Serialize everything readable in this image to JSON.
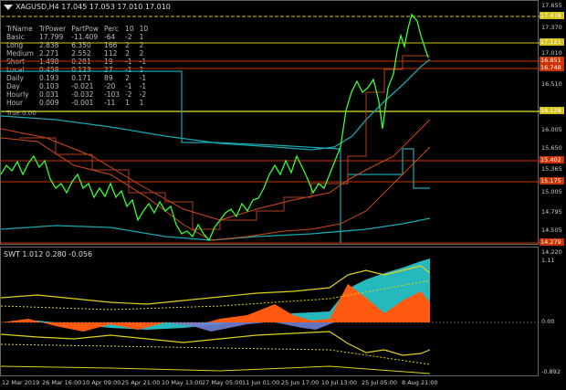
{
  "window": {
    "symbol_header": "XAGUSD,H4  17.045 17.053 17.010 17.010",
    "icon": "triangle-down-icon"
  },
  "stats_table": {
    "headers": [
      "TrName",
      "TrPower",
      "PartPow",
      "Perc",
      "10",
      "10"
    ],
    "rows": [
      [
        "Basic",
        "17.799",
        "-11.409",
        "-64",
        "-2",
        "1"
      ],
      [
        "Long",
        "2.838",
        "6.350",
        "166",
        "2",
        "2"
      ],
      [
        "Medium",
        "2.271",
        "2.552",
        "112",
        "2",
        "2"
      ],
      [
        "Short",
        "1.498",
        "0.281",
        "19",
        "-1",
        "-1"
      ],
      [
        "Local",
        "0.458",
        "0.123",
        "27",
        "-1",
        "1"
      ],
      [
        "Daily",
        "0.193",
        "0.171",
        "89",
        "2",
        "-1"
      ],
      [
        "Day",
        "0.103",
        "-0.021",
        "-20",
        "-1",
        "-1"
      ],
      [
        "Hourly",
        "0.031",
        "-0.032",
        "-103",
        "-2",
        "-2"
      ],
      [
        "Hour",
        "0.009",
        "-0.001",
        "-11",
        "1",
        "1"
      ]
    ],
    "footer": "True 0.00"
  },
  "price_axis": {
    "labels": [
      "17.655",
      "17.370",
      "17.010",
      "16.510",
      "16.005",
      "15.650",
      "15.365",
      "15.005",
      "14.795",
      "14.505",
      "14.220"
    ],
    "badges": [
      {
        "value": "17.478",
        "color": "#d4c21a"
      },
      {
        "value": "17.121",
        "color": "#d4c21a"
      },
      {
        "value": "16.851",
        "color": "#cc3300"
      },
      {
        "value": "16.748",
        "color": "#cc3300"
      },
      {
        "value": "16.128",
        "color": "#d4c21a"
      },
      {
        "value": "15.402",
        "color": "#cc3300"
      },
      {
        "value": "15.175",
        "color": "#cc3300"
      },
      {
        "value": "14.279",
        "color": "#cc3300"
      }
    ]
  },
  "oscillator": {
    "title": "SWT 1.012 0.280 -0.056",
    "axis_labels": [
      "1.11",
      "0.00",
      "-0.892"
    ]
  },
  "time_axis": {
    "labels": [
      "12 Mar 2019",
      "26 Mar 16:00",
      "10 Apr 09:00",
      "25 Apr 21:00",
      "10 May 13:00",
      "27 May 05:00",
      "11 Jun 01:00",
      "25 Jun 17:00",
      "10 Jul 13:00",
      "25 Jul 05:00",
      "8 Aug 21:00"
    ]
  },
  "colors": {
    "price": "#33ff33",
    "cyan": "#1aa7b0",
    "orange": "#d04a1a",
    "yellow": "#e0d020",
    "grid": "#666666"
  }
}
